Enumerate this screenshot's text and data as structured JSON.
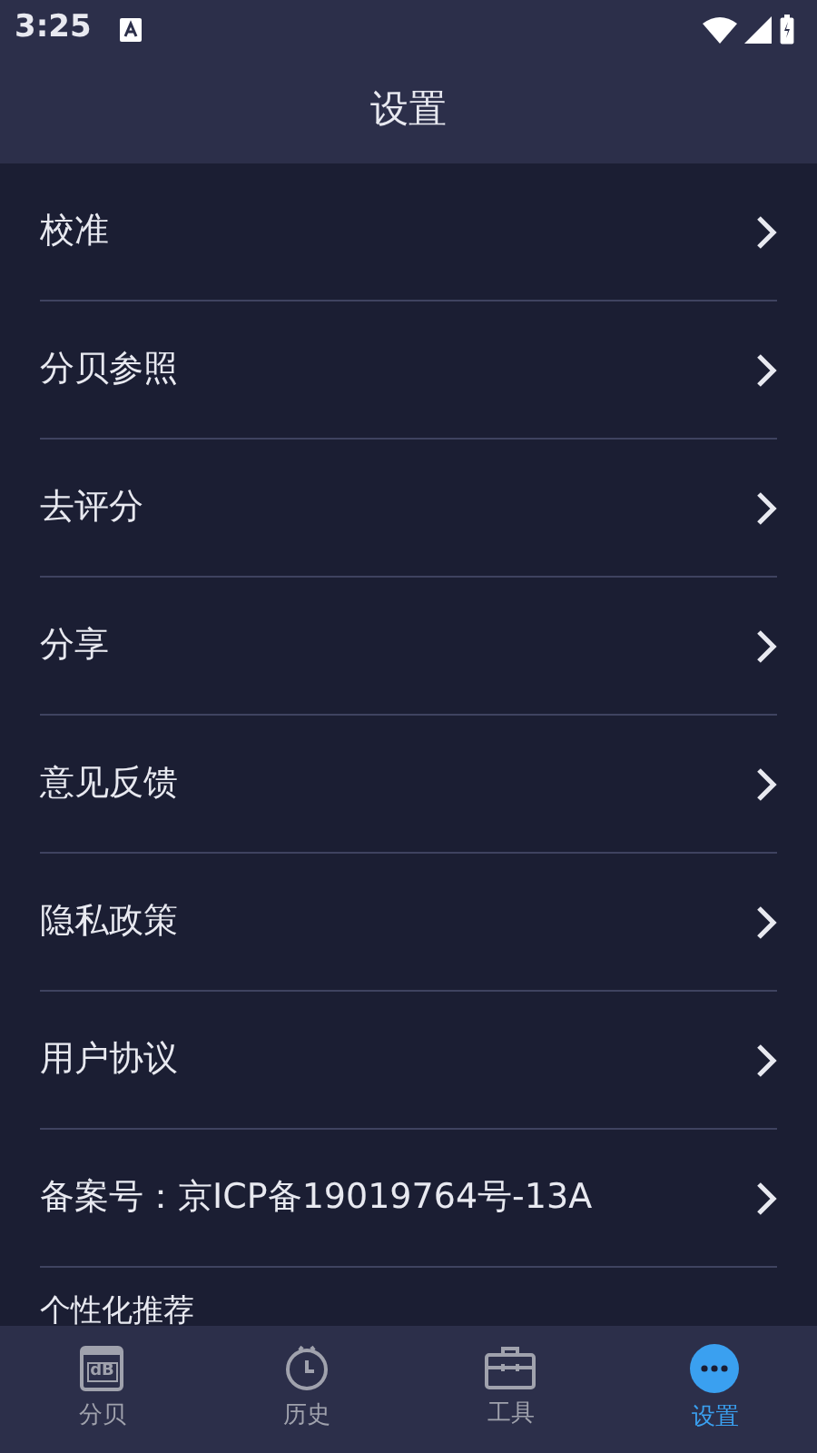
{
  "status_bar": {
    "time": "3:25"
  },
  "header": {
    "title": "设置"
  },
  "settings": [
    {
      "label": "校准"
    },
    {
      "label": "分贝参照"
    },
    {
      "label": "去评分"
    },
    {
      "label": "分享"
    },
    {
      "label": "意见反馈"
    },
    {
      "label": "隐私政策"
    },
    {
      "label": "用户协议"
    },
    {
      "label": "备案号：京ICP备19019764号-13A"
    }
  ],
  "section_heading": "个性化推荐",
  "bottom_nav": [
    {
      "kind": "decibel",
      "label": "分贝",
      "icon_text": "dB",
      "selected": false
    },
    {
      "kind": "history",
      "label": "历史",
      "selected": false
    },
    {
      "kind": "tools",
      "label": "工具",
      "selected": false
    },
    {
      "kind": "settings",
      "label": "设置",
      "selected": true
    }
  ]
}
